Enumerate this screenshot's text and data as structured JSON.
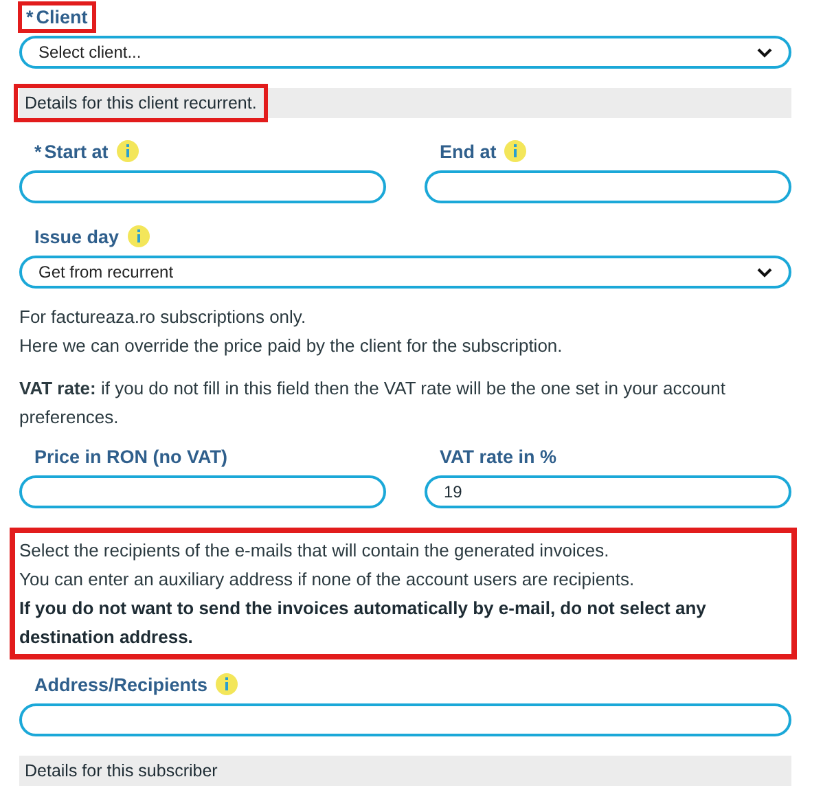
{
  "blocks": [
    {
      "kind": "select",
      "marker": "*",
      "label": "Client",
      "highlighted": true,
      "value": "Select client..."
    },
    {
      "kind": "section",
      "text": "Details for this client recurrent.",
      "highlighted": true
    },
    {
      "kind": "pair",
      "fields": [
        {
          "marker": "*",
          "label": "Start at",
          "info": true
        },
        {
          "label": "End at",
          "info": true
        }
      ]
    },
    {
      "kind": "select",
      "label": "Issue day",
      "info": true,
      "value": "Get from recurrent"
    },
    {
      "kind": "note",
      "lines": [
        {
          "text": "For factureaza.ro subscriptions only.",
          "bold": false
        },
        {
          "text": "Here we can override the price paid by the client for the subscription.",
          "bold": false
        }
      ]
    },
    {
      "kind": "note",
      "lines": [
        {
          "text": "**VAT rate:** if you do not fill in this field then the VAT rate will be the one set in your account preferences.",
          "bold": false
        }
      ]
    },
    {
      "kind": "pair",
      "fields": [
        {
          "label": "Price in RON (no VAT)"
        },
        {
          "label": "VAT rate in %",
          "value": "19"
        }
      ]
    },
    {
      "kind": "note",
      "highlighted": true,
      "lines": [
        {
          "text": "Select the recipients of the e-mails that will contain the generated invoices.",
          "bold": false
        },
        {
          "text": "You can enter an auxiliary address if none of the account users are recipients.",
          "bold": false
        },
        {
          "text": "If you do not want to send the invoices automatically by e-mail, do not select any destination address.",
          "bold": true
        }
      ]
    },
    {
      "kind": "input",
      "label": "Address/Recipients",
      "info": true
    },
    {
      "kind": "section",
      "text": "Details for this subscriber"
    }
  ]
}
